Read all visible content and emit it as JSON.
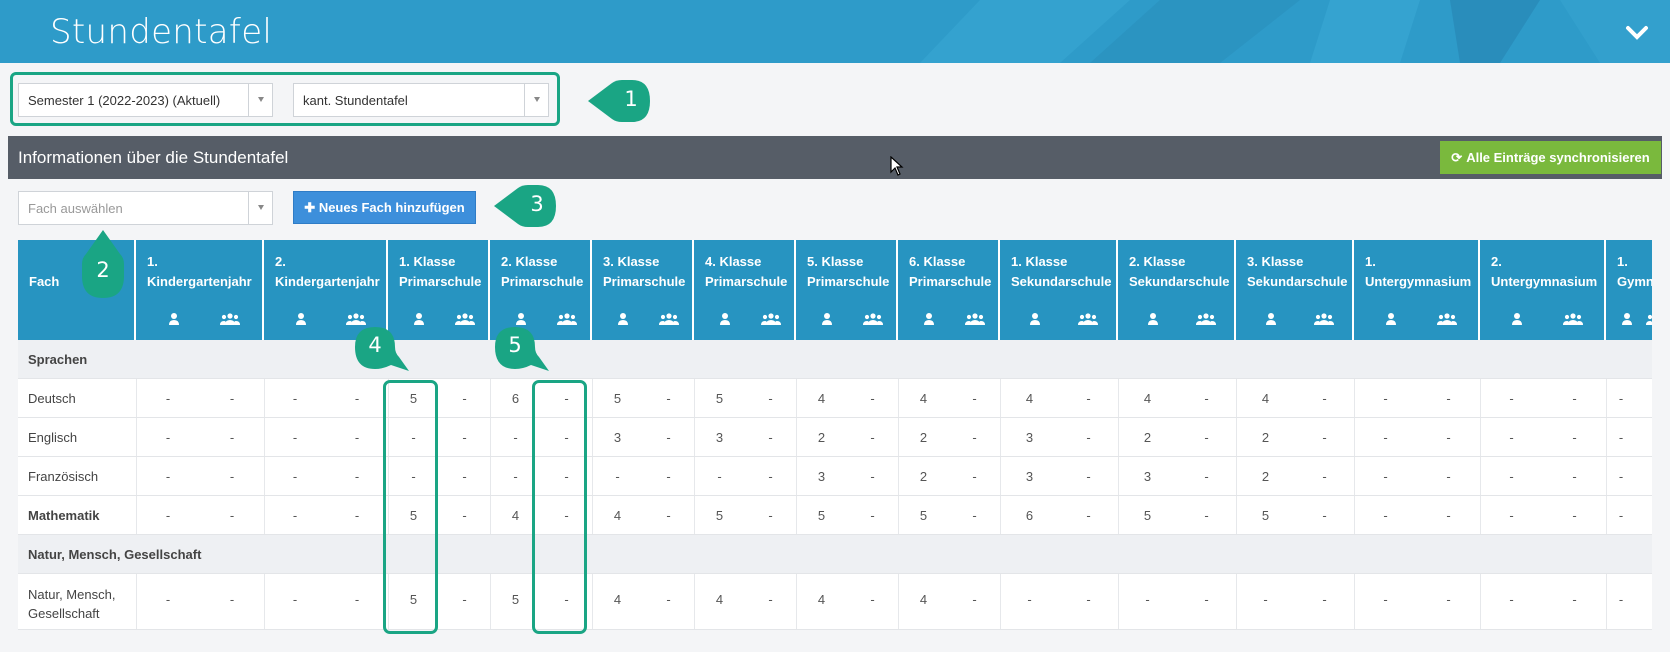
{
  "header": {
    "title": "Stundentafel"
  },
  "filters": {
    "semester": "Semester 1 (2022-2023) (Aktuell)",
    "table_type": "kant. Stundentafel"
  },
  "info": {
    "title": "Informationen über die Stundentafel",
    "sync_button": "Alle Einträge synchronisieren"
  },
  "subject_select": {
    "placeholder": "Fach auswählen"
  },
  "add_button": "Neues Fach hinzufügen",
  "callouts": [
    "1",
    "2",
    "3",
    "4",
    "5"
  ],
  "table": {
    "fach_header": "Fach",
    "columns": [
      [
        "1.",
        "Kindergartenjahr"
      ],
      [
        "2.",
        "Kindergartenjahr"
      ],
      [
        "1. Klasse",
        "Primarschule"
      ],
      [
        "2. Klasse",
        "Primarschule"
      ],
      [
        "3. Klasse",
        "Primarschule"
      ],
      [
        "4. Klasse",
        "Primarschule"
      ],
      [
        "5. Klasse",
        "Primarschule"
      ],
      [
        "6. Klasse",
        "Primarschule"
      ],
      [
        "1. Klasse",
        "Sekundarschule"
      ],
      [
        "2. Klasse",
        "Sekundarschule"
      ],
      [
        "3. Klasse",
        "Sekundarschule"
      ],
      [
        "1.",
        "Untergymnasium"
      ],
      [
        "2.",
        "Untergymnasium"
      ],
      [
        "1.",
        "Gymn"
      ]
    ],
    "rows": [
      {
        "type": "group",
        "label": "Sprachen"
      },
      {
        "type": "data",
        "label": "Deutsch",
        "bold": false,
        "values": [
          "-",
          "-",
          "-",
          "-",
          "5",
          "-",
          "6",
          "-",
          "5",
          "-",
          "5",
          "-",
          "4",
          "-",
          "4",
          "-",
          "4",
          "-",
          "4",
          "-",
          "4",
          "-",
          "-",
          "-",
          "-",
          "-",
          "-"
        ]
      },
      {
        "type": "data",
        "label": "Englisch",
        "bold": false,
        "values": [
          "-",
          "-",
          "-",
          "-",
          "-",
          "-",
          "-",
          "-",
          "3",
          "-",
          "3",
          "-",
          "2",
          "-",
          "2",
          "-",
          "3",
          "-",
          "2",
          "-",
          "2",
          "-",
          "-",
          "-",
          "-",
          "-",
          "-"
        ]
      },
      {
        "type": "data",
        "label": "Französisch",
        "bold": false,
        "values": [
          "-",
          "-",
          "-",
          "-",
          "-",
          "-",
          "-",
          "-",
          "-",
          "-",
          "-",
          "-",
          "3",
          "-",
          "2",
          "-",
          "3",
          "-",
          "3",
          "-",
          "2",
          "-",
          "-",
          "-",
          "-",
          "-",
          "-"
        ]
      },
      {
        "type": "data",
        "label": "Mathematik",
        "bold": true,
        "values": [
          "-",
          "-",
          "-",
          "-",
          "5",
          "-",
          "4",
          "-",
          "4",
          "-",
          "5",
          "-",
          "5",
          "-",
          "5",
          "-",
          "6",
          "-",
          "5",
          "-",
          "5",
          "-",
          "-",
          "-",
          "-",
          "-",
          "-"
        ]
      },
      {
        "type": "group",
        "label": "Natur, Mensch, Gesellschaft"
      },
      {
        "type": "data",
        "label": "Natur, Mensch, Gesellschaft",
        "label_lines": [
          "Natur, Mensch,",
          "Gesellschaft"
        ],
        "bold": false,
        "values": [
          "-",
          "-",
          "-",
          "-",
          "5",
          "-",
          "5",
          "-",
          "4",
          "-",
          "4",
          "-",
          "4",
          "-",
          "4",
          "-",
          "-",
          "-",
          "-",
          "-",
          "-",
          "-",
          "-",
          "-",
          "-",
          "-",
          "-"
        ]
      }
    ]
  }
}
